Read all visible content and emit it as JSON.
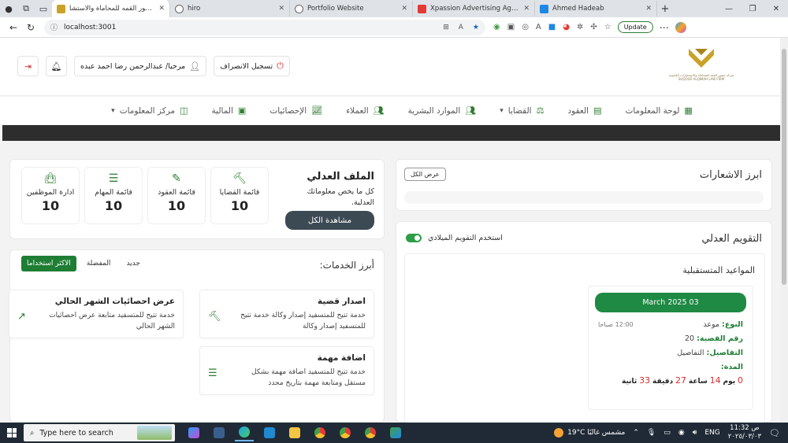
{
  "browser": {
    "tabs": [
      {
        "label": "شركة صقور القمه للمحاماة والاستشا",
        "active": true,
        "color": "#c9a227"
      },
      {
        "label": "hiro",
        "active": false,
        "color": "#888888"
      },
      {
        "label": "Portfolio Website",
        "active": false,
        "color": "#888888"
      },
      {
        "label": "Xpassion Advertising Agency",
        "active": false,
        "color": "#e53935"
      },
      {
        "label": "Ahmed Hadeab",
        "active": false,
        "color": "#1e88e5"
      }
    ],
    "url": "localhost:3001",
    "update_label": "Update"
  },
  "header": {
    "logout_label": "تسجيل الانصراف",
    "greeting": "مرحبا/ عبدالرحمن رضا احمد عبده",
    "logo_lines": [
      "شركة صقور القمة للمحاماة والاستشارات القانونية",
      "SUQOUR ALQIMAH LAW FIRM"
    ]
  },
  "nav": {
    "items": [
      {
        "label": "لوحة المعلومات",
        "icon": "dashboard-icon",
        "dropdown": false
      },
      {
        "label": "العقود",
        "icon": "contracts-icon",
        "dropdown": false
      },
      {
        "label": "القضايا",
        "icon": "scales-icon",
        "dropdown": true
      },
      {
        "label": "الموارد البشرية",
        "icon": "people-icon",
        "dropdown": false
      },
      {
        "label": "العملاء",
        "icon": "clients-icon",
        "dropdown": false
      },
      {
        "label": "الإحصائيات",
        "icon": "chart-icon",
        "dropdown": false
      },
      {
        "label": "المالية",
        "icon": "money-icon",
        "dropdown": false
      },
      {
        "label": "مركز المعلومات",
        "icon": "info-center-icon",
        "dropdown": true
      }
    ]
  },
  "file": {
    "title": "الملف العدلي",
    "description": "كل ما يخص معلوماتك العدلية.",
    "view_all": "مشاهدة الكل",
    "stats": [
      {
        "label": "قائمة القضايا",
        "value": "10",
        "icon": "gavel-icon"
      },
      {
        "label": "قائمة العقود",
        "value": "10",
        "icon": "edit-contract-icon"
      },
      {
        "label": "قائمة المهام",
        "value": "10",
        "icon": "tasks-icon"
      },
      {
        "label": "ادارة الموظفين",
        "value": "10",
        "icon": "briefcase-icon"
      }
    ]
  },
  "notifications": {
    "title": "ابرز الاشعارات",
    "view_all": "عرض الكل"
  },
  "services": {
    "title": "أبرز الخدمات:",
    "tabs": [
      "الاكثر استخداما",
      "المفضلة",
      "جديد"
    ],
    "active_tab": 0,
    "cards": [
      {
        "title": "اصدار قضية",
        "desc": "خدمة تتيح للمتسفيد إصدار وكالة خدمة تتيح للمتسفيد إصدار وكالة",
        "icon": "gavel-icon"
      },
      {
        "title": "عرض احصائيات الشهر الحالي",
        "desc": "خدمة تتيح للمتسفيد متابعة عرض احصائيات الشهر الحالي",
        "icon": "trend-icon"
      },
      {
        "title": "اضافة مهمة",
        "desc": "خدمة تتيح للمتسفيد اضافة مهمة بشكل مستقل ومتابعة مهمة بتاريخ محدد",
        "icon": "tasks-icon"
      }
    ]
  },
  "calendar": {
    "title": "التقويم العدلي",
    "toggle_label": "استخدم التقويم الميلادي",
    "toggle_on": true,
    "upcoming_title": "المواعيد المتستقبلية",
    "appointment": {
      "date": "March 2025 03",
      "type_key": "النوع:",
      "type_value": "موعد",
      "time": "12:00 صباحا",
      "case_key": "رقم القضية:",
      "case_value": "20",
      "details_key": "التفاصيل:",
      "details_value": "التفاصيل",
      "duration_key": "المدة:",
      "days": "0",
      "days_label": "يوم",
      "hours": "14",
      "hours_label": "ساعة",
      "minutes": "27",
      "minutes_label": "دقيقة",
      "seconds": "33",
      "seconds_label": "ثانية"
    }
  },
  "taskbar": {
    "search_placeholder": "Type here to search",
    "weather": "19°C مشمس غالبًا",
    "lang": "ENG",
    "time": "11:32 ص",
    "date": "٢٠٢٥/٠٣/٠٣"
  },
  "colors": {
    "accent": "#1e7e34",
    "dark_button": "#3c4a54",
    "danger": "#d32f2f"
  }
}
